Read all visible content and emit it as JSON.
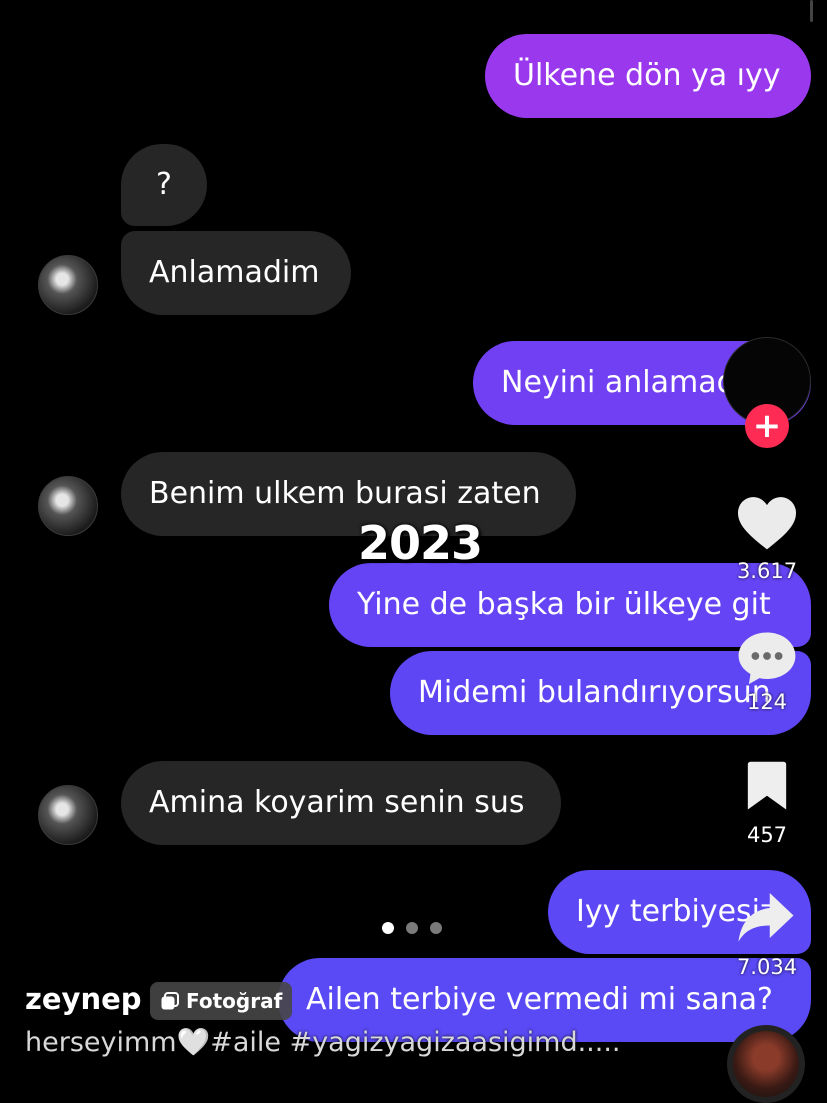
{
  "messages": [
    {
      "id": "m1",
      "text": "Ülkene dön ya ıyy",
      "side": "sent"
    },
    {
      "id": "m2",
      "text": "?",
      "side": "received"
    },
    {
      "id": "m3",
      "text": "Anlamadim",
      "side": "received"
    },
    {
      "id": "m4",
      "text": "Neyini anlamadın",
      "side": "sent"
    },
    {
      "id": "m5",
      "text": "Benim ulkem burasi zaten",
      "side": "received"
    },
    {
      "id": "m6",
      "text": "Yine de başka bir ülkeye git",
      "side": "sent"
    },
    {
      "id": "m7",
      "text": "Midemi bulandırıyorsun",
      "side": "sent"
    },
    {
      "id": "m8",
      "text": "Amina koyarim senin sus",
      "side": "received"
    },
    {
      "id": "m9",
      "text": "Iyy terbiyesiz",
      "side": "sent"
    },
    {
      "id": "m10",
      "text": "Ailen terbiye vermedi mi sana?",
      "side": "sent"
    }
  ],
  "overlay": {
    "year_text": "2023"
  },
  "actions": {
    "follow_symbol": "+",
    "likes": "3.617",
    "comments": "124",
    "saves": "457",
    "shares": "7.034"
  },
  "post": {
    "username": "zeynep",
    "photo_tag": "Fotoğraf",
    "caption": "herseyimm🤍#aile #yagizyagizaasigimd....."
  },
  "carousel": {
    "count": 3,
    "active_index": 0
  },
  "colors": {
    "sent_bubble_top": "#8a3ff0",
    "sent_bubble_bottom": "#5b4cf5",
    "received_bubble": "#262626",
    "follow_button": "#fe2c55"
  },
  "icons": [
    "heart-icon",
    "comment-icon",
    "bookmark-icon",
    "share-icon",
    "photo-icon",
    "plus-icon"
  ]
}
